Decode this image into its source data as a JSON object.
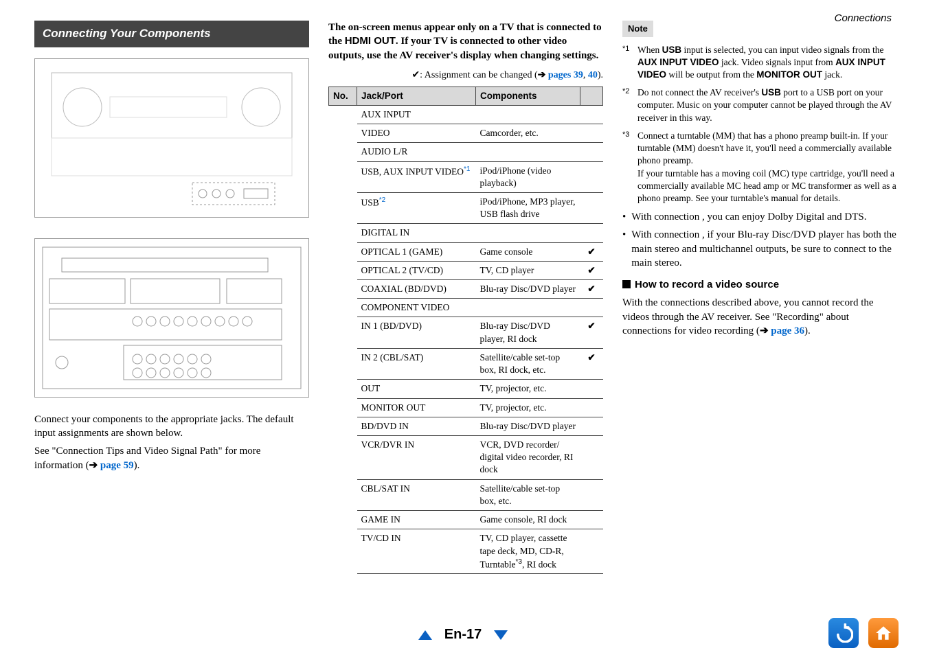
{
  "header": {
    "breadcrumb": "Connections"
  },
  "section": {
    "title": "Connecting Your Components"
  },
  "col1": {
    "p1": "Connect your components to the appropriate jacks. The default input assignments are shown below.",
    "p2a": "See \"Connection Tips and Video Signal Path\" for more information (",
    "p2_link": "page 59",
    "p2b": ")."
  },
  "col2": {
    "intro": "The on-screen menus appear only on a TV that is connected to the HDMI OUT. If your TV is connected to other video outputs, use the AV receiver's display when changing settings.",
    "assign_a": "✔: Assignment can be changed (",
    "assign_link1": "pages 39",
    "assign_mid": ", ",
    "assign_link2": "40",
    "assign_b": ").",
    "table": {
      "h_no": "No.",
      "h_jack": "Jack/Port",
      "h_comp": "Components",
      "rows": [
        {
          "jack": "AUX INPUT",
          "comp": "",
          "tick": ""
        },
        {
          "jack": "VIDEO",
          "comp": "Camcorder, etc.",
          "tick": ""
        },
        {
          "jack": "AUDIO L/R",
          "comp": "",
          "tick": ""
        },
        {
          "jack": "USB, AUX INPUT VIDEO",
          "sup": "*1",
          "comp": "iPod/iPhone (video playback)",
          "tick": ""
        },
        {
          "jack": "USB",
          "sup": "*2",
          "comp": "iPod/iPhone, MP3 player, USB flash drive",
          "tick": ""
        },
        {
          "jack": "DIGITAL IN",
          "comp": "",
          "tick": "",
          "group": true
        },
        {
          "jack": "OPTICAL 1 (GAME)",
          "comp": "Game console",
          "tick": "✔"
        },
        {
          "jack": "OPTICAL 2 (TV/CD)",
          "comp": "TV, CD player",
          "tick": "✔"
        },
        {
          "jack": "COAXIAL (BD/DVD)",
          "comp": "Blu-ray Disc/DVD player",
          "tick": "✔"
        },
        {
          "jack": "COMPONENT VIDEO",
          "comp": "",
          "tick": "",
          "group": true
        },
        {
          "jack": "IN 1 (BD/DVD)",
          "comp": "Blu-ray Disc/DVD player, RI dock",
          "tick": "✔"
        },
        {
          "jack": "IN 2 (CBL/SAT)",
          "comp": "Satellite/cable set-top box, RI dock, etc.",
          "tick": "✔"
        },
        {
          "jack": "OUT",
          "comp": "TV, projector, etc.",
          "tick": ""
        },
        {
          "jack": "MONITOR OUT",
          "comp": "TV, projector, etc.",
          "tick": ""
        },
        {
          "jack": "BD/DVD IN",
          "comp": "Blu-ray Disc/DVD player",
          "tick": ""
        },
        {
          "jack": "VCR/DVR IN",
          "comp": "VCR, DVD recorder/ digital video recorder, RI dock",
          "tick": ""
        },
        {
          "jack": "CBL/SAT IN",
          "comp": "Satellite/cable set-top box, etc.",
          "tick": ""
        },
        {
          "jack": "GAME IN",
          "comp": "Game console, RI dock",
          "tick": ""
        },
        {
          "jack": "TV/CD IN",
          "comp": "TV, CD player, cassette tape deck, MD, CD-R, Turntable",
          "sup2": "*3",
          "comp_tail": ", RI dock",
          "tick": ""
        }
      ]
    }
  },
  "col3": {
    "note_label": "Note",
    "fn1_idx": "*1",
    "fn1": "When USB input is selected, you can input video signals from the AUX INPUT VIDEO jack. Video signals input from AUX INPUT VIDEO will be output from the MONITOR OUT jack.",
    "fn2_idx": "*2",
    "fn2": "Do not connect the AV receiver's USB port to a USB port on your computer. Music on your computer cannot be played through the AV receiver in this way.",
    "fn3_idx": "*3",
    "fn3": "Connect a turntable (MM) that has a phono preamp built-in. If your turntable (MM) doesn't have it, you'll need a commercially available phono preamp.",
    "fn3b": "If your turntable has a moving coil (MC) type cartridge, you'll need a commercially available MC head amp or MC transformer as well as a phono preamp. See your turntable's manual for details.",
    "b1": "With connection    , you can enjoy Dolby Digital and DTS.",
    "b2": "With connection    , if your Blu-ray Disc/DVD player has both the main stereo and multichannel outputs, be sure to connect to the main stereo.",
    "sub": "How to record a video source",
    "p3a": "With the connections described above, you cannot record the videos through the AV receiver. See \"Recording\" about connections for video recording (",
    "p3_link": "page 36",
    "p3b": ")."
  },
  "footer": {
    "page": "En-17"
  },
  "icons": {
    "back": "↶",
    "home": "⌂"
  }
}
